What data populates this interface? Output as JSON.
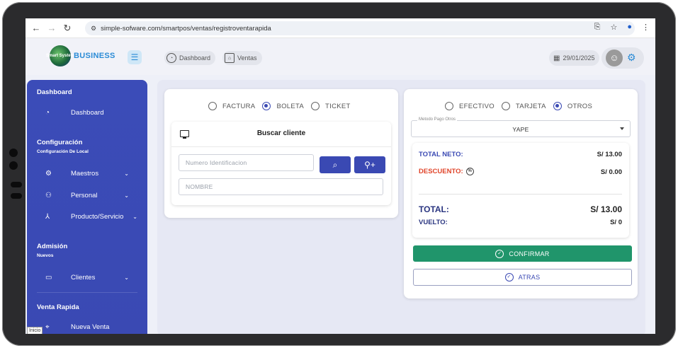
{
  "browser": {
    "url": "simple-sofware.com/smartpos/ventas/registroventarapida"
  },
  "brand": {
    "logo_small_text": "Smart System",
    "name": "BUSINESS"
  },
  "breadcrumbs": [
    {
      "label": "Dashboard",
      "icon": "dashboard-icon"
    },
    {
      "label": "Ventas",
      "icon": "basket-icon"
    }
  ],
  "header": {
    "date": "29/01/2025"
  },
  "sidebar": {
    "sections": [
      {
        "title": "Dashboard",
        "subtitle": ""
      },
      {
        "title": "Configuración",
        "subtitle": "Configuración De Local"
      },
      {
        "title": "Admisión",
        "subtitle": "Nuevos"
      },
      {
        "title": "Venta Rapida",
        "subtitle": ""
      }
    ],
    "items": [
      {
        "label": "Dashboard",
        "icon": "dashboard-icon"
      },
      {
        "label": "Maestros",
        "icon": "gear-icon",
        "chevron": "⌄"
      },
      {
        "label": "Personal",
        "icon": "users-icon",
        "chevron": "⌄"
      },
      {
        "label": "Producto/Servicio",
        "icon": "hierarchy-icon",
        "chevron": "⌄"
      },
      {
        "label": "Clientes",
        "icon": "id-card-icon",
        "chevron": "⌄"
      },
      {
        "label": "Nueva Venta",
        "icon": "cart-icon"
      }
    ],
    "tooltip": "Inicio"
  },
  "doc_type": {
    "options": [
      "FACTURA",
      "BOLETA",
      "TICKET"
    ],
    "selected": "BOLETA"
  },
  "client": {
    "title": "Buscar cliente",
    "id_placeholder": "Numero Identificacion",
    "name_placeholder": "NOMBRE"
  },
  "payment": {
    "options": [
      "EFECTIVO",
      "TARJETA",
      "OTROS"
    ],
    "selected": "OTROS",
    "select_label": "Metodo Pago Otros",
    "select_value": "YAPE"
  },
  "totals": {
    "neto_label": "TOTAL NETO:",
    "neto_value": "S/ 13.00",
    "descuento_label": "DESCUENTO:",
    "descuento_value": "S/ 0.00",
    "total_label": "TOTAL:",
    "total_value": "S/ 13.00",
    "vuelto_label": "VUELTO:",
    "vuelto_value": "S/ 0"
  },
  "actions": {
    "confirm_label": "CONFIRMAR",
    "back_label": "ATRAS"
  },
  "colors": {
    "primary": "#3a49b3",
    "confirm": "#20956b",
    "descuento": "#e0442a",
    "neto": "#3a49b3"
  }
}
